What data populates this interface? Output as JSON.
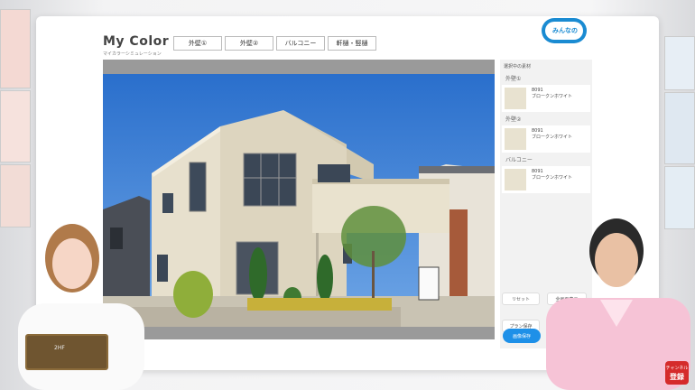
{
  "app": {
    "logo": "My Color",
    "logo_sub": "マイカラーシミュレーション"
  },
  "tabs": [
    "外壁①",
    "外壁②",
    "バルコニー",
    "軒樋・竪樋"
  ],
  "sidepanel": {
    "title": "選択中の素材",
    "sections": [
      {
        "label": "外壁①",
        "code": "8091",
        "name": "ブロークンホワイト",
        "color": "#e8e2d0"
      },
      {
        "label": "外壁②",
        "code": "8091",
        "name": "ブロークンホワイト",
        "color": "#e8e2d0"
      },
      {
        "label": "バルコニー",
        "code": "8091",
        "name": "ブロークンホワイト",
        "color": "#e8e2d0"
      }
    ],
    "buttons": {
      "reset": "リセット",
      "fullscreen": "全画面表示",
      "save_plan": "プラン保存",
      "plan": "プラ",
      "save_image": "画像保存"
    }
  },
  "channel": {
    "badge": "みんなの",
    "title": "塗装講座"
  },
  "tablet": {
    "text": "2HF"
  },
  "subscribe": {
    "line1": "チャンネル",
    "line2": "登録"
  },
  "colors": {
    "accent": "#1e90e8",
    "wall": "#e8e2d0",
    "sky": "#2f7fd6"
  }
}
